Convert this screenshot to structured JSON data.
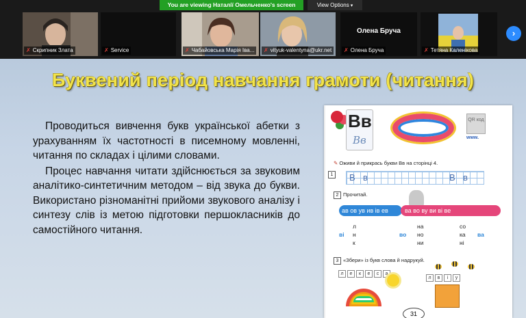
{
  "banner": {
    "viewing_text": "You are viewing Наталії Омельченко's screen",
    "view_options_label": "View Options",
    "view_options_icon": "chevron-down-icon"
  },
  "participants": [
    {
      "name": "Скрипник Злата",
      "muted": true
    },
    {
      "name": "Service",
      "muted": true
    },
    {
      "name": "Чабайовська Марія Іва...",
      "muted": true
    },
    {
      "name": "vityuk-valentyna@ukr.net",
      "muted": true
    },
    {
      "name": "Олена Бруча",
      "muted": true,
      "title": "Олена Бруча"
    },
    {
      "name": "Тетяна Каленікова",
      "muted": true
    }
  ],
  "slide": {
    "title": "Буквений період навчання грамоти (читання)",
    "paragraphs": [
      "Проводиться вивчення букв української абетки з урахуванням їх частотності в писемному мовленні, читання по складах і цілими словами.",
      "Процес навчання читати здійснюється за звуковим аналітико-синтетичним методом – від звука до букви. Використано різноманітні прийоми звукового аналізу і синтезу слів із метою підготовки першокласників до самостійного читання."
    ]
  },
  "textbook": {
    "letter": "Вв",
    "script_letter": "Вв",
    "qr_label": "QR код",
    "www": "www.",
    "task1": "Оживи й прикрась букви Вв на сторінці 4.",
    "task1_num": "1",
    "task2_label": "Прочитай.",
    "task2_num": "2",
    "row1": "ав ов ув ив ів ев",
    "row2": "ва во ву ви ві ве",
    "tree1": {
      "root": "ві",
      "branches": [
        "л",
        "н",
        "к"
      ]
    },
    "tree2": {
      "root": "во",
      "branches": [
        "на",
        "но",
        "ни"
      ]
    },
    "tree3": {
      "root": "ва",
      "branches": [
        "со",
        "ка",
        "ні"
      ]
    },
    "task3": "«Збери» із букв слова й надрукуй.",
    "task3_num": "3",
    "letters_left": [
      "л",
      "е",
      "к",
      "е",
      "с",
      "а"
    ],
    "letters_right": [
      "л",
      "в",
      "і",
      "у"
    ],
    "page_number": "31"
  }
}
